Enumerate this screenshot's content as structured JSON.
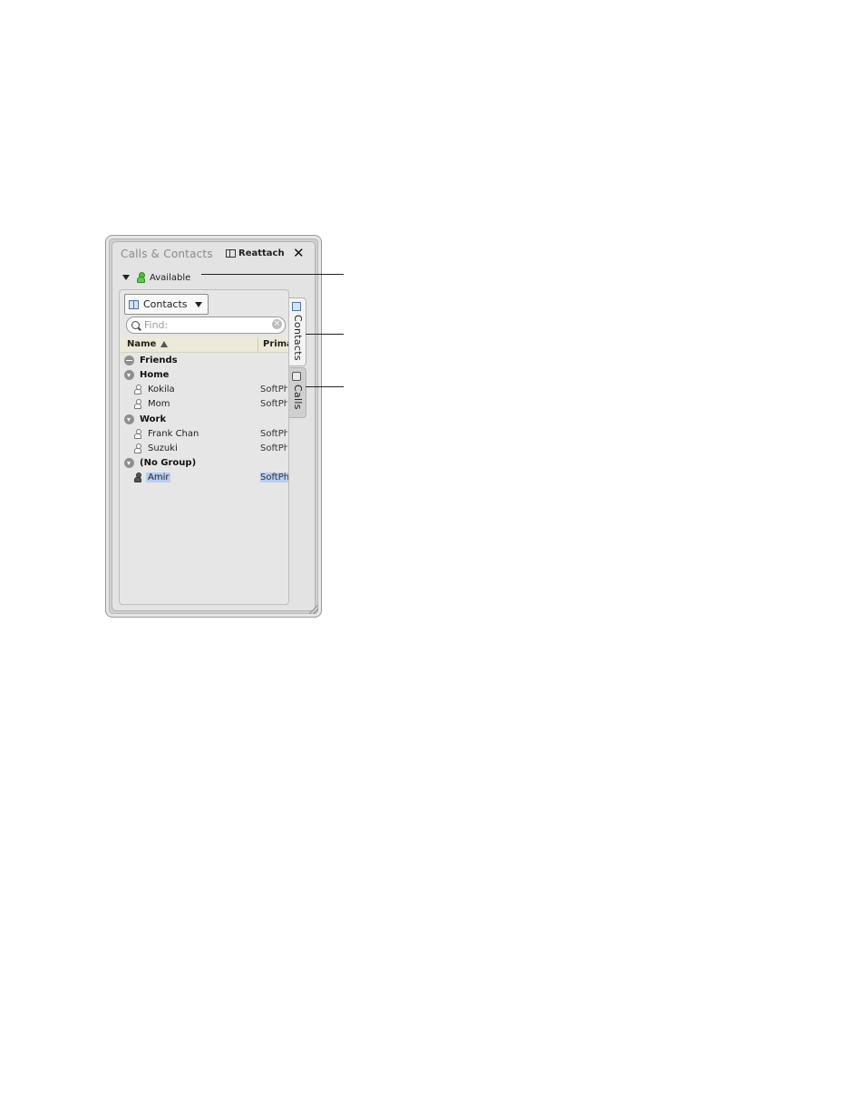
{
  "window": {
    "title": "Calls & Contacts",
    "reattach_label": "Reattach",
    "close_glyph": "✕"
  },
  "presence": {
    "status": "Available",
    "color": "#4fbf3a"
  },
  "panel": {
    "view_dropdown": {
      "selected": "Contacts"
    },
    "search": {
      "placeholder": "Find:",
      "value": ""
    },
    "columns": {
      "name": "Name",
      "primary": "Prima"
    },
    "groups": [
      {
        "label": "Friends",
        "state": "collapsed",
        "contacts": []
      },
      {
        "label": "Home",
        "state": "expanded",
        "contacts": [
          {
            "name": "Kokila",
            "primary": "SoftPh",
            "selected": false
          },
          {
            "name": "Mom",
            "primary": "SoftPh",
            "selected": false
          }
        ]
      },
      {
        "label": "Work",
        "state": "expanded",
        "contacts": [
          {
            "name": "Frank Chan",
            "primary": "SoftPh",
            "selected": false
          },
          {
            "name": "Suzuki",
            "primary": "SoftPh",
            "selected": false
          }
        ]
      },
      {
        "label": "(No Group)",
        "state": "expanded",
        "contacts": [
          {
            "name": "Amir",
            "primary": "SoftPh",
            "selected": true
          }
        ]
      }
    ]
  },
  "tabs": [
    {
      "label": "Contacts",
      "active": true
    },
    {
      "label": "Calls",
      "active": false
    }
  ],
  "colors": {
    "selection": "#b7cdf2",
    "header_bg": "#ece9d8"
  }
}
